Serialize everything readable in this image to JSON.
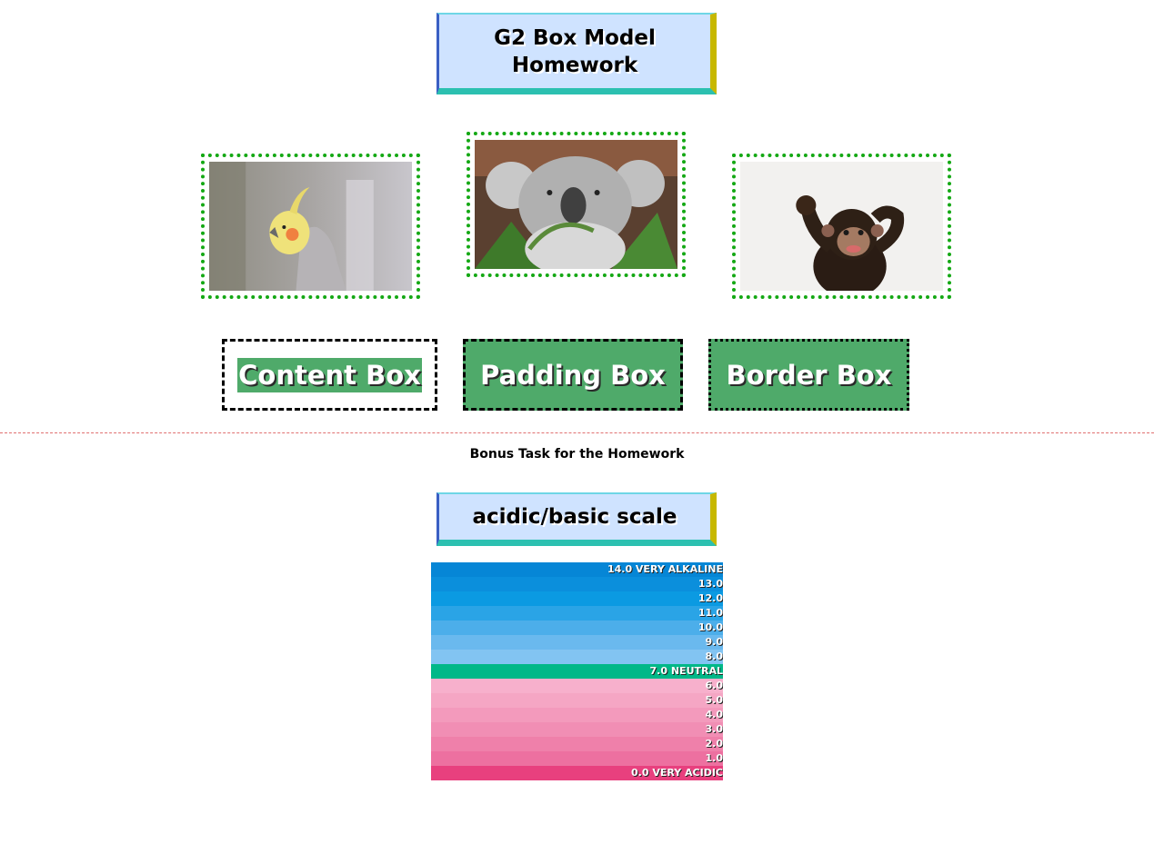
{
  "header": {
    "title_line1": "G2 Box Model",
    "title_line2": "Homework"
  },
  "gallery": {
    "images": [
      {
        "name": "cockatiel",
        "alt": "Cockatiel parrot"
      },
      {
        "name": "koala",
        "alt": "Koala eating leaves"
      },
      {
        "name": "chimpanzee",
        "alt": "Young chimpanzee"
      }
    ]
  },
  "boxes": {
    "content": "Content Box",
    "padding": "Padding Box",
    "border": "Border Box"
  },
  "bonus": {
    "label": "Bonus Task for the Homework"
  },
  "scale": {
    "title": "acidic/basic scale",
    "rows": [
      {
        "label": "14.0 VERY ALKALINE",
        "color": "#0686d6"
      },
      {
        "label": "13.0",
        "color": "#0b8fdc"
      },
      {
        "label": "12.0",
        "color": "#0b9ae2"
      },
      {
        "label": "11.0",
        "color": "#2aa4e6"
      },
      {
        "label": "10.0",
        "color": "#4caeea"
      },
      {
        "label": "9.0",
        "color": "#6ab9ee"
      },
      {
        "label": "8.0",
        "color": "#82c4f2"
      },
      {
        "label": "7.0 NEUTRAL",
        "color": "#00b888"
      },
      {
        "label": "6.0",
        "color": "#f7b0cc"
      },
      {
        "label": "5.0",
        "color": "#f5a6c4"
      },
      {
        "label": "4.0",
        "color": "#f39abc"
      },
      {
        "label": "3.0",
        "color": "#f18eb4"
      },
      {
        "label": "2.0",
        "color": "#ef80aa"
      },
      {
        "label": "1.0",
        "color": "#ed70a0"
      },
      {
        "label": "0.0 VERY ACIDIC",
        "color": "#e8407e"
      }
    ]
  }
}
